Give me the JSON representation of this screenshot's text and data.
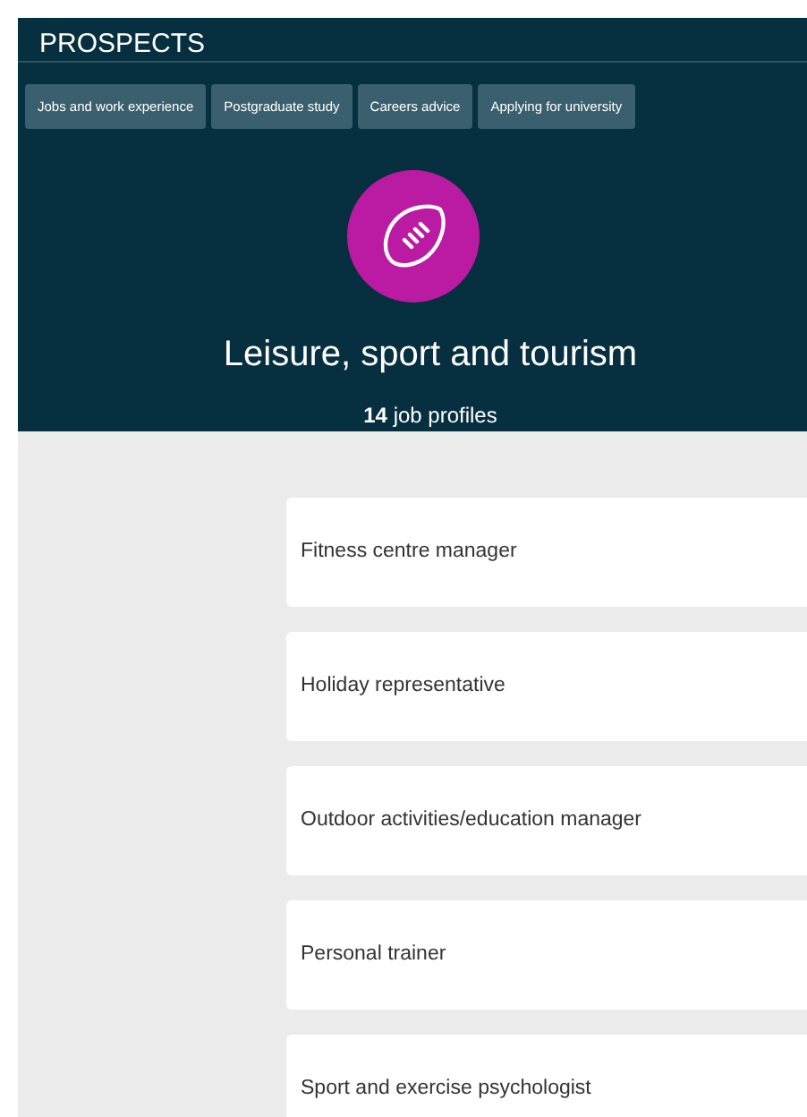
{
  "header": {
    "logo": "PROSPECTS",
    "nav": [
      {
        "label": "Jobs and work experience"
      },
      {
        "label": "Postgraduate study"
      },
      {
        "label": "Careers advice"
      },
      {
        "label": "Applying for university"
      }
    ],
    "title": "Leisure, sport and tourism",
    "subtitle": "**14** job profiles"
  },
  "job_profiles": [
    {
      "title": "Fitness centre manager"
    },
    {
      "title": "Holiday representative"
    },
    {
      "title": "Outdoor activities/education manager"
    },
    {
      "title": "Personal trainer"
    },
    {
      "title": "Sport and exercise psychologist"
    }
  ]
}
